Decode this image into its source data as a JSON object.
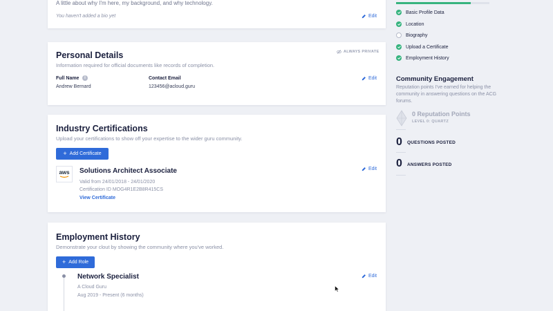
{
  "bio": {
    "intro": "A little about why I'm here, my background, and why technology.",
    "empty_text": "You haven't added a bio yet",
    "edit_label": "Edit"
  },
  "personal": {
    "title": "Personal Details",
    "subtitle": "Information required for official documents like records of completion.",
    "privacy_badge": "ALWAYS PRIVATE",
    "full_name_label": "Full Name",
    "full_name_value": "Andrew Bernard",
    "email_label": "Contact Email",
    "email_value": "123456@acloud.guru",
    "edit_label": "Edit"
  },
  "certs": {
    "title": "Industry Certifications",
    "subtitle": "Upload your certifications to show off your expertise to the wider guru community.",
    "add_button": "Add Certificate",
    "logo_text": "aws",
    "items": [
      {
        "name": "Solutions Architect Associate",
        "valid": "Valid from 24/01/2018 - 24/01/2020",
        "cert_id": "Certification ID MOG4R1E2B8R415CS",
        "view_link": "View Certificate",
        "edit_label": "Edit"
      }
    ]
  },
  "employment": {
    "title": "Employment History",
    "subtitle": "Demonstrate your clout by showing the community where you've worked.",
    "add_button": "Add Role",
    "items": [
      {
        "role": "Network Specialist",
        "company": "A Cloud Guru",
        "period": "Aug 2019 - Present (6 months)",
        "edit_label": "Edit"
      }
    ]
  },
  "sidebar": {
    "progress": 0.8,
    "checklist": [
      {
        "label": "Basic Profile Data",
        "done": true
      },
      {
        "label": "Location",
        "done": true
      },
      {
        "label": "Biography",
        "done": false
      },
      {
        "label": "Upload a Certificate",
        "done": true
      },
      {
        "label": "Employment History",
        "done": true
      }
    ],
    "community": {
      "title": "Community Engagement",
      "subtitle": "Reputation points I've earned for helping the community in answering questions on the ACG forums.",
      "reputation": "0 Reputation Points",
      "level": "LEVEL 0: QUARTZ",
      "questions_count": "0",
      "questions_label": "QUESTIONS POSTED",
      "answers_count": "0",
      "answers_label": "ANSWERS POSTED"
    }
  },
  "colors": {
    "accent": "#2f6bd9",
    "success": "#36b37e",
    "background": "#eef0f5"
  }
}
